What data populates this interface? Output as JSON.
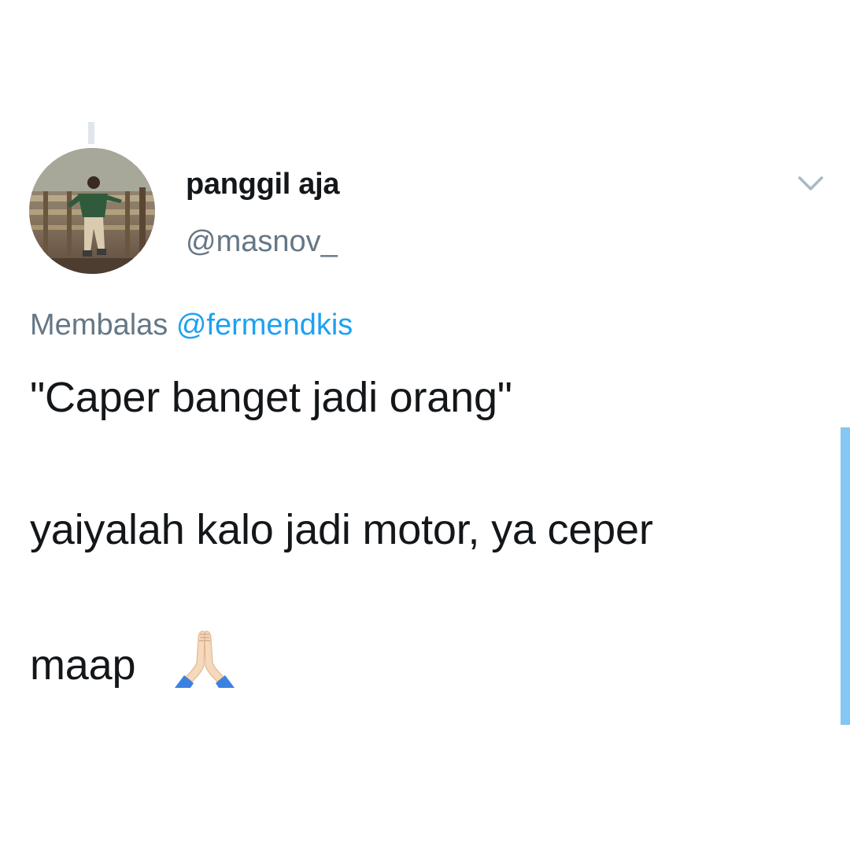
{
  "tweet": {
    "display_name": "panggil aja",
    "handle": "@masnov_",
    "reply_prefix": "Membalas",
    "reply_to": "@fermendkis",
    "lines": [
      "\"Caper banget jadi orang\"",
      "yaiyalah kalo jadi motor, ya ceper",
      "maap"
    ],
    "emoji": "folded-hands-icon"
  },
  "icons": {
    "menu": "chevron-down-icon",
    "avatar": "avatar"
  },
  "colors": {
    "text_primary": "#14171a",
    "text_secondary": "#657786",
    "mention": "#1da1f2",
    "scrollbar": "#86c6f4",
    "thread_line": "#dfe6ec"
  }
}
